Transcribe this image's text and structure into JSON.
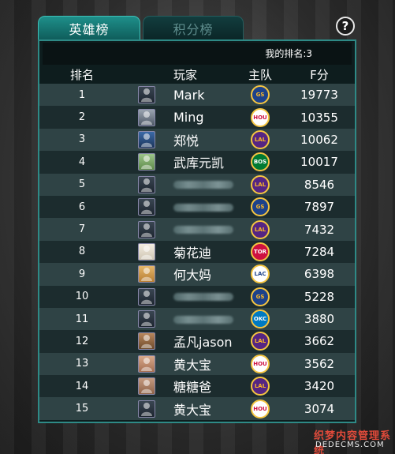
{
  "tabs": {
    "hero": "英雄榜",
    "points": "积分榜"
  },
  "help_symbol": "?",
  "my_rank": "我的排名:3",
  "columns": {
    "rank": "排名",
    "player": "玩家",
    "team": "主队",
    "score": "F分"
  },
  "rows": [
    {
      "rank": "1",
      "name": "Mark",
      "team": "GS",
      "score": "19773",
      "avatar": "a1",
      "team_colors": [
        "#1d428a",
        "#fdb927"
      ]
    },
    {
      "rank": "2",
      "name": "Ming",
      "team": "HOU",
      "score": "10355",
      "avatar": "a2",
      "team_colors": [
        "#ffffff",
        "#ce1141"
      ]
    },
    {
      "rank": "3",
      "name": "郑悦",
      "team": "LAL",
      "score": "10062",
      "avatar": "a3",
      "team_colors": [
        "#552583",
        "#fdb927"
      ]
    },
    {
      "rank": "4",
      "name": "武库元凯",
      "team": "BOS",
      "score": "10017",
      "avatar": "a4",
      "team_colors": [
        "#007a33",
        "#ffffff"
      ]
    },
    {
      "rank": "5",
      "name": "",
      "team": "LAL",
      "score": "8546",
      "avatar": "a1",
      "team_colors": [
        "#552583",
        "#fdb927"
      ],
      "blurred": true
    },
    {
      "rank": "6",
      "name": "",
      "team": "GS",
      "score": "7897",
      "avatar": "a1",
      "team_colors": [
        "#1d428a",
        "#fdb927"
      ],
      "blurred": true
    },
    {
      "rank": "7",
      "name": "",
      "team": "LAL",
      "score": "7432",
      "avatar": "a1",
      "team_colors": [
        "#552583",
        "#fdb927"
      ],
      "blurred": true
    },
    {
      "rank": "8",
      "name": "菊花迪",
      "team": "TOR",
      "score": "7284",
      "avatar": "a5",
      "team_colors": [
        "#ce1141",
        "#ffffff"
      ]
    },
    {
      "rank": "9",
      "name": "何大妈",
      "team": "LAC",
      "score": "6398",
      "avatar": "a6",
      "team_colors": [
        "#ffffff",
        "#1d428a"
      ]
    },
    {
      "rank": "10",
      "name": "",
      "team": "GS",
      "score": "5228",
      "avatar": "a1",
      "team_colors": [
        "#1d428a",
        "#fdb927"
      ],
      "blurred": true
    },
    {
      "rank": "11",
      "name": "",
      "team": "OKC",
      "score": "3880",
      "avatar": "a1",
      "team_colors": [
        "#007ac1",
        "#ffffff"
      ],
      "blurred": true
    },
    {
      "rank": "12",
      "name": "孟凡jason",
      "team": "LAL",
      "score": "3662",
      "avatar": "a7",
      "team_colors": [
        "#552583",
        "#fdb927"
      ]
    },
    {
      "rank": "13",
      "name": "黄大宝",
      "team": "HOU",
      "score": "3562",
      "avatar": "a8",
      "team_colors": [
        "#ffffff",
        "#ce1141"
      ]
    },
    {
      "rank": "14",
      "name": "糖糖爸",
      "team": "LAL",
      "score": "3420",
      "avatar": "a9",
      "team_colors": [
        "#552583",
        "#fdb927"
      ]
    },
    {
      "rank": "15",
      "name": "黄大宝",
      "team": "HOU",
      "score": "3074",
      "avatar": "a1",
      "team_colors": [
        "#ffffff",
        "#ce1141"
      ]
    }
  ],
  "watermark": {
    "logo": "织梦内容管理系统",
    "url": "DEDECMS.COM"
  }
}
